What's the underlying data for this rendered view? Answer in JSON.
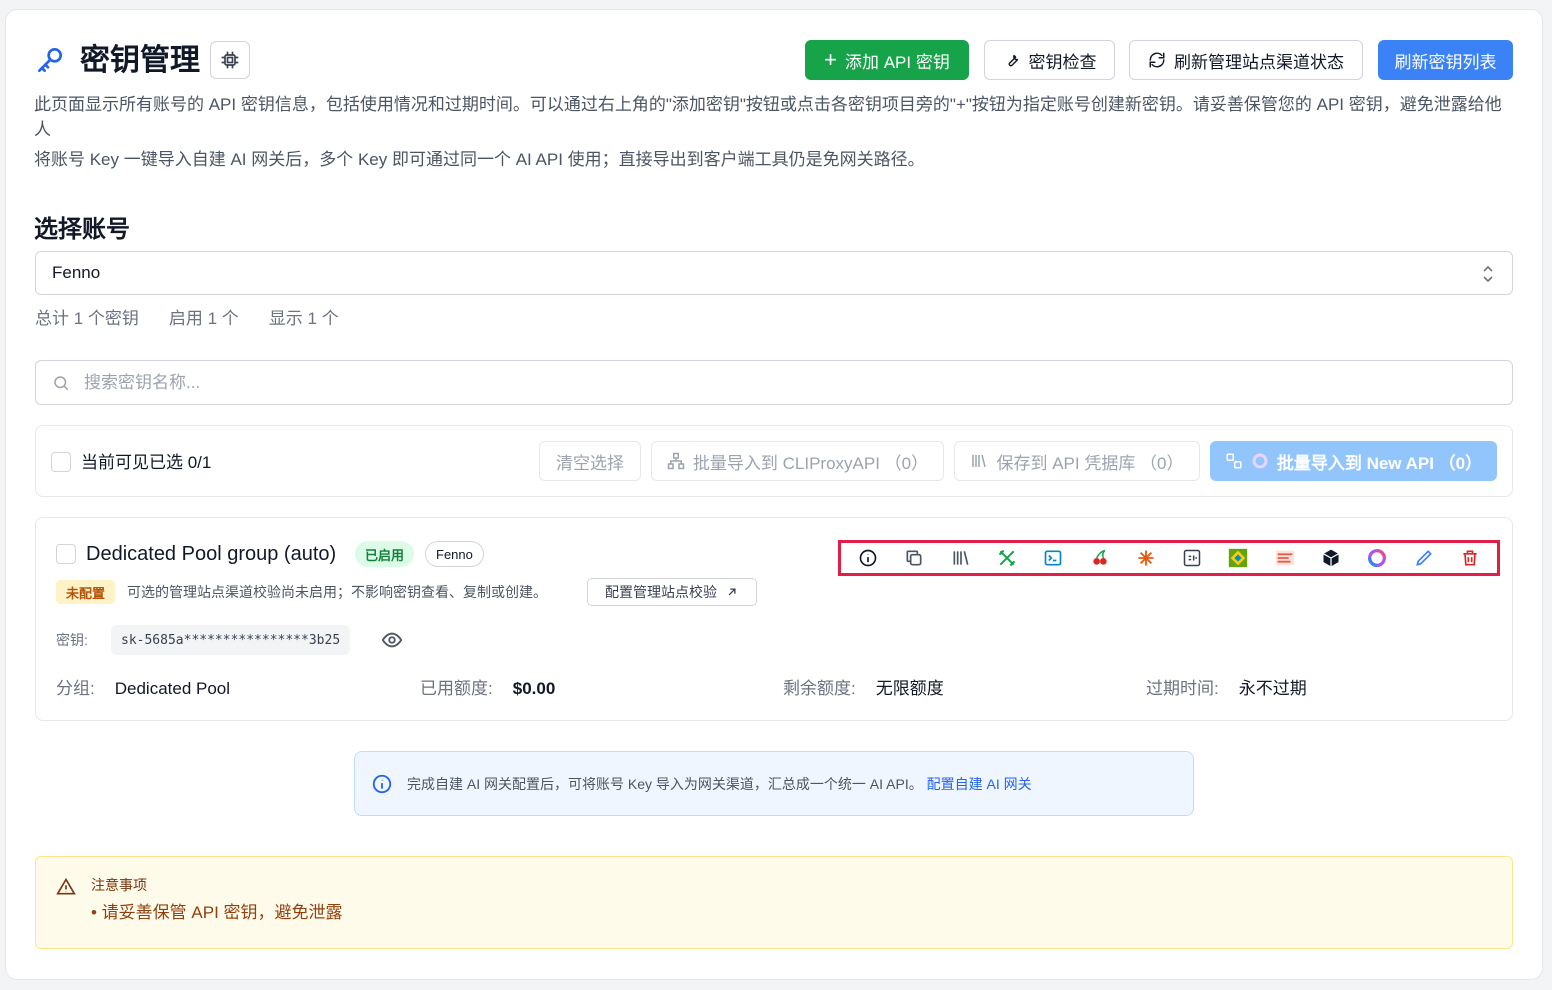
{
  "header": {
    "title": "密钥管理",
    "buttons": {
      "add": "添加 API 密钥",
      "check": "密钥检查",
      "refresh_site": "刷新管理站点渠道状态",
      "refresh_list": "刷新密钥列表"
    },
    "description": "此页面显示所有账号的 API 密钥信息，包括使用情况和过期时间。可以通过右上角的\"添加密钥\"按钮或点击各密钥项目旁的\"+\"按钮为指定账号创建新密钥。请妥善保管您的 API 密钥，避免泄露给他人",
    "description2": "将账号 Key 一键导入自建 AI 网关后，多个 Key 即可通过同一个 AI API 使用；直接导出到客户端工具仍是免网关路径。"
  },
  "account": {
    "section_title": "选择账号",
    "selected": "Fenno",
    "stats": {
      "total": "总计 1 个密钥",
      "enabled": "启用 1 个",
      "shown": "显示 1 个"
    }
  },
  "search": {
    "placeholder": "搜索密钥名称..."
  },
  "bulk": {
    "selected_label": "当前可见已选 0/1",
    "clear": "清空选择",
    "cliproxy": "批量导入到 CLIProxyAPI （0）",
    "save_vault": "保存到 API 凭据库 （0）",
    "newapi": "批量导入到 New API （0）"
  },
  "key_item": {
    "name": "Dedicated Pool group (auto)",
    "status_badge": "已启用",
    "account_badge": "Fenno",
    "warn_badge": "未配置",
    "warn_text": "可选的管理站点渠道校验尚未启用；不影响密钥查看、复制或创建。",
    "config_button": "配置管理站点校验",
    "key_label": "密钥:",
    "key_value": "sk-5685a****************3b25",
    "group_label": "分组:",
    "group_value": "Dedicated Pool",
    "used_label": "已用额度:",
    "used_value": "$0.00",
    "remain_label": "剩余额度:",
    "remain_value": "无限额度",
    "expire_label": "过期时间:",
    "expire_value": "永不过期"
  },
  "toolbar_icons": [
    "info-icon",
    "copy-icon",
    "library-icon",
    "tools-icon",
    "terminal-icon",
    "cherry-icon",
    "sparkle-icon",
    "ai-chip-icon",
    "cube-logo-icon",
    "brand-logo-icon",
    "box-icon",
    "newapi-logo-icon",
    "edit-icon",
    "delete-icon"
  ],
  "info_banner": {
    "text": "完成自建 AI 网关配置后，可将账号 Key 导入为网关渠道，汇总成一个统一 AI API。",
    "link": "配置自建 AI 网关"
  },
  "notice": {
    "title": "注意事项",
    "item": "• 请妥善保管 API 密钥，避免泄露"
  },
  "colors": {
    "primary": "#3b82f6",
    "success": "#16a34a",
    "danger": "#dc2626",
    "highlight_border": "#e11d48",
    "warning_bg": "#fffbeb"
  }
}
